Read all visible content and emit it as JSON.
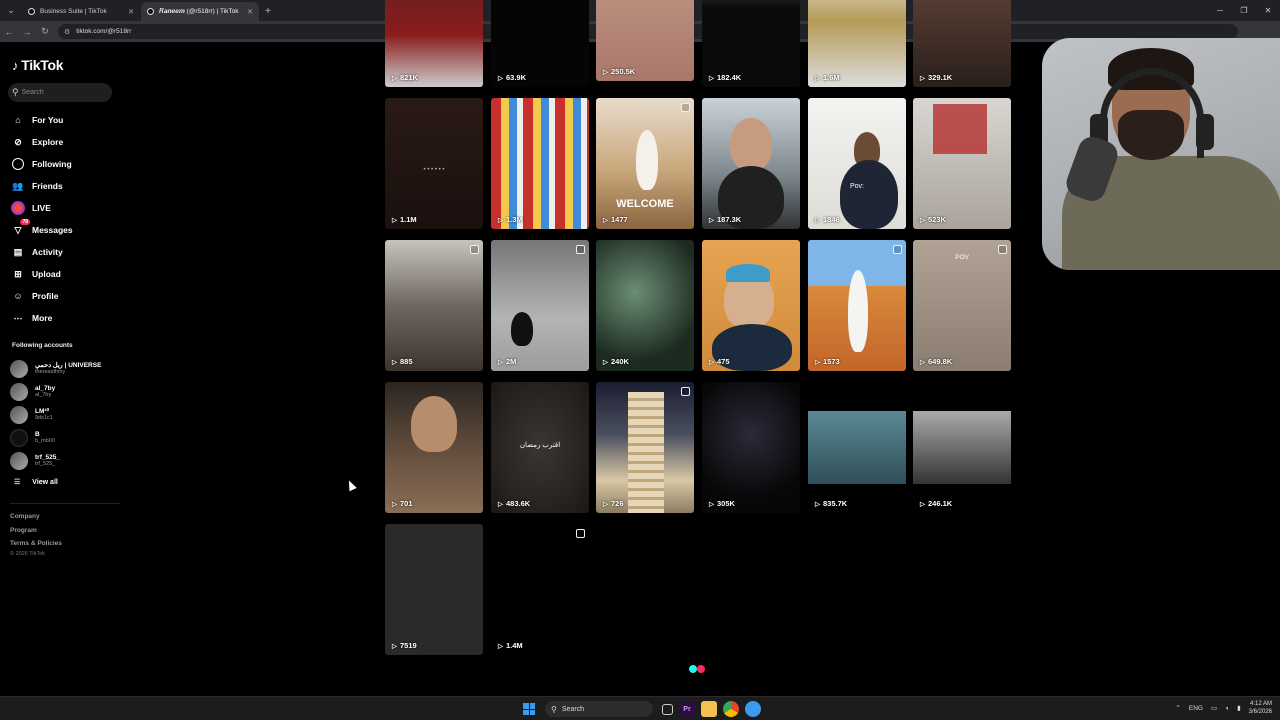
{
  "browser": {
    "tabs": [
      {
        "title": "Business Suite | TikTok",
        "active": false
      },
      {
        "title": "𝑹𝒂𝒏𝒆𝒆𝒎 (@r518rr) | TikTok",
        "active": true
      }
    ],
    "new_tab": "+",
    "url": "tiktok.com/@r518rr"
  },
  "sidebar": {
    "logo": "TikTok",
    "search_placeholder": "Search",
    "nav": [
      {
        "label": "For You",
        "icon": "home-icon"
      },
      {
        "label": "Explore",
        "icon": "compass-icon"
      },
      {
        "label": "Following",
        "icon": "following-icon"
      },
      {
        "label": "Friends",
        "icon": "friends-icon"
      },
      {
        "label": "LIVE",
        "icon": "live-icon"
      },
      {
        "label": "Messages",
        "icon": "messages-icon",
        "badge": "78"
      },
      {
        "label": "Activity",
        "icon": "activity-icon"
      },
      {
        "label": "Upload",
        "icon": "upload-icon"
      },
      {
        "label": "Profile",
        "icon": "profile-icon"
      },
      {
        "label": "More",
        "icon": "more-icon"
      }
    ],
    "following_title": "Following accounts",
    "accounts": [
      {
        "name": "ريل دحمي | UNIVERSE",
        "handle": "thereaidhmy"
      },
      {
        "name": "al_7by",
        "handle": "al_7by"
      },
      {
        "name": "LM¹⁰",
        "handle": "9dx1c1"
      },
      {
        "name": "B",
        "handle": "b_mb00"
      },
      {
        "name": "trf_525_",
        "handle": "trf_525_"
      }
    ],
    "view_all": "View all",
    "footer": [
      "Company",
      "Program",
      "Terms & Policies"
    ],
    "copyright": "© 2026 TikTok"
  },
  "videos": [
    {
      "views": "821K",
      "caption": "",
      "big": ""
    },
    {
      "views": "63.9K",
      "caption": "",
      "big": ""
    },
    {
      "views": "250.5K",
      "caption": "",
      "big": ""
    },
    {
      "views": "182.4K",
      "caption": "",
      "big": ""
    },
    {
      "views": "1.6M",
      "caption": "",
      "big": ""
    },
    {
      "views": "329.1K",
      "caption": "",
      "big": ""
    },
    {
      "views": "1.1M",
      "caption": "",
      "big": ""
    },
    {
      "views": "1.3M",
      "caption": "",
      "big": ""
    },
    {
      "views": "1477",
      "caption": "",
      "big": "WELCOME"
    },
    {
      "views": "187.3K",
      "caption": "",
      "big": ""
    },
    {
      "views": "1846",
      "caption": "Pov:",
      "big": ""
    },
    {
      "views": "523K",
      "caption": "",
      "big": ""
    },
    {
      "views": "885",
      "caption": "",
      "big": ""
    },
    {
      "views": "2M",
      "caption": "",
      "big": ""
    },
    {
      "views": "240K",
      "caption": "",
      "big": ""
    },
    {
      "views": "475",
      "caption": "",
      "big": ""
    },
    {
      "views": "1573",
      "caption": "",
      "big": ""
    },
    {
      "views": "649.8K",
      "caption": "POV",
      "big": ""
    },
    {
      "views": "701",
      "caption": "",
      "big": ""
    },
    {
      "views": "483.6K",
      "caption": "اقترب رمضان",
      "big": ""
    },
    {
      "views": "726",
      "caption": "",
      "big": ""
    },
    {
      "views": "305K",
      "caption": "",
      "big": ""
    },
    {
      "views": "835.7K",
      "caption": "",
      "big": ""
    },
    {
      "views": "246.1K",
      "caption": "",
      "big": ""
    },
    {
      "views": "7519",
      "caption": "",
      "big": ""
    },
    {
      "views": "1.4M",
      "caption": "",
      "big": ""
    }
  ],
  "taskbar": {
    "search": "Search",
    "lang": "ENG",
    "time": "4:12 AM",
    "date": "3/6/2026"
  }
}
